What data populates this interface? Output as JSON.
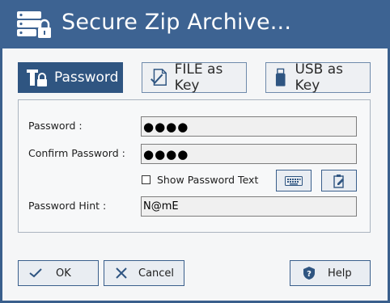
{
  "window": {
    "title": "Secure Zip Archive..."
  },
  "tabs": [
    {
      "label": "Password",
      "icon": "password-lock-icon",
      "active": true
    },
    {
      "label": "FILE as Key",
      "icon": "file-key-icon",
      "active": false
    },
    {
      "label": "USB as Key",
      "icon": "usb-drive-icon",
      "active": false
    }
  ],
  "form": {
    "password_label": "Password :",
    "password_value": "●●●●",
    "confirm_label": "Confirm Password :",
    "confirm_value": "●●●●",
    "show_password_label": "Show Password Text",
    "show_password_checked": false,
    "hint_label": "Password Hint :",
    "hint_value": "N@mE"
  },
  "buttons": {
    "ok": "OK",
    "cancel": "Cancel",
    "help": "Help"
  },
  "colors": {
    "titlebar": "#3d6392",
    "accent": "#2f5581",
    "border": "#3a5f8c"
  }
}
